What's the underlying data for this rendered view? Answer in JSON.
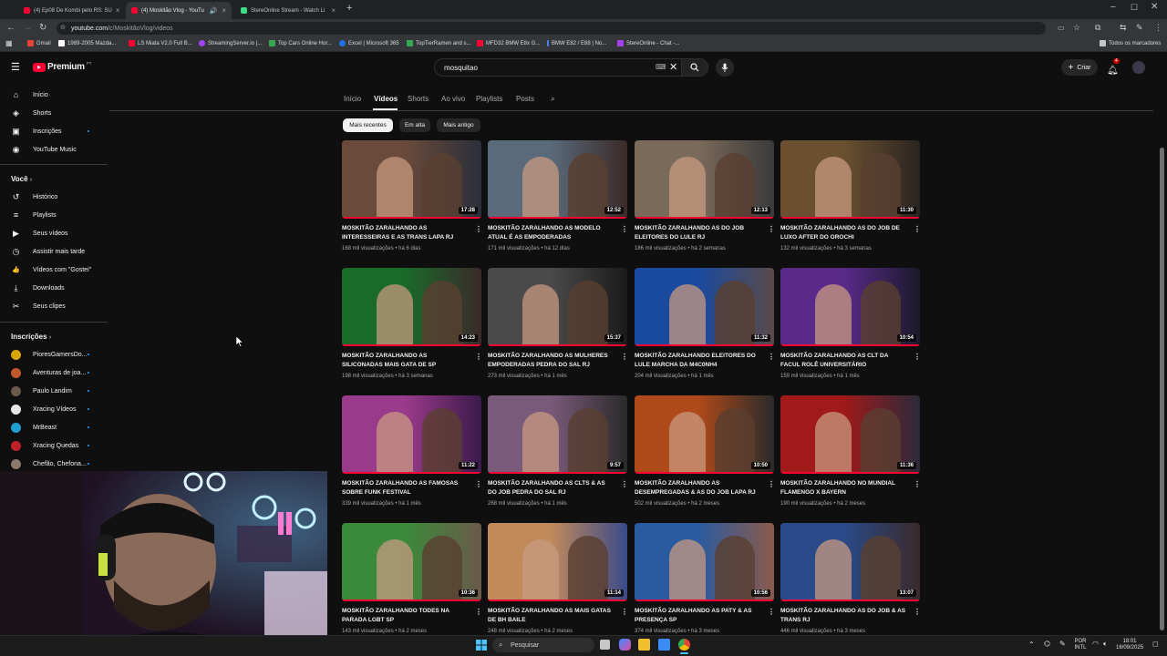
{
  "browser": {
    "tabs": [
      {
        "title": "(4) Ep08 De Kombi pelo RS: SU",
        "active": false,
        "color": "#ff0033"
      },
      {
        "title": "(4) Moskitão Vlog - YouTu",
        "active": true,
        "color": "#ff0033"
      },
      {
        "title": "StereOnline Stream - Watch Li",
        "active": false,
        "color": "#3ddc84"
      }
    ],
    "new_tab": "+",
    "url_host": "youtube.com",
    "url_path": "/c/MoskitãoVlog/videos",
    "bookmarks": [
      {
        "label": "Gmail",
        "color": "#ea4335"
      },
      {
        "label": "1989-2005 Mazda...",
        "color": "#ffffff"
      },
      {
        "label": "LS Miata V2.0 Full B...",
        "color": "#ff0033"
      },
      {
        "label": "StreamingServer.io |...",
        "color": "#a142f4"
      },
      {
        "label": "Top Cars Online Hor...",
        "color": "#34a853"
      },
      {
        "label": "Excel | Microsoft 365",
        "color": "#1a73e8"
      },
      {
        "label": "TopTierRamen and s...",
        "color": "#34a853"
      },
      {
        "label": "MFD32 BMW E8x G...",
        "color": "#ff0033"
      },
      {
        "label": "BMW E82 / E88 | No...",
        "color": "#4285f4"
      },
      {
        "label": "StereOnline - Chat -...",
        "color": "#a142f4"
      }
    ],
    "all_bookmarks": "Todos os marcadores"
  },
  "header": {
    "logo_text": "Premium",
    "logo_sup": "PT",
    "search_value": "mosquitao",
    "create_label": "Criar",
    "notif_count": "4"
  },
  "sidebar": {
    "main": [
      {
        "label": "Início",
        "icon": "home-icon",
        "glyph": "⌂"
      },
      {
        "label": "Shorts",
        "icon": "shorts-icon",
        "glyph": "◈"
      },
      {
        "label": "Inscrições",
        "icon": "subscriptions-icon",
        "glyph": "▣"
      },
      {
        "label": "YouTube Music",
        "icon": "music-icon",
        "glyph": "◉"
      }
    ],
    "you_header": "Você",
    "you": [
      {
        "label": "Histórico",
        "icon": "history-icon",
        "glyph": "↺"
      },
      {
        "label": "Playlists",
        "icon": "playlists-icon",
        "glyph": "≡"
      },
      {
        "label": "Seus vídeos",
        "icon": "your-videos-icon",
        "glyph": "▶"
      },
      {
        "label": "Assistir mais tarde",
        "icon": "watch-later-icon",
        "glyph": "◷"
      },
      {
        "label": "Vídeos com \"Gostei\"",
        "icon": "like-icon",
        "glyph": "👍"
      },
      {
        "label": "Downloads",
        "icon": "download-icon",
        "glyph": "⤓"
      },
      {
        "label": "Seus clipes",
        "icon": "clips-icon",
        "glyph": "✂"
      }
    ],
    "subs_header": "Inscrições",
    "subs": [
      {
        "label": "PioresGamersDo...",
        "color": "#d8a600"
      },
      {
        "label": "Aventuras de joa...",
        "color": "#c0582b"
      },
      {
        "label": "Paulo Landim",
        "color": "#6a5a4a"
      },
      {
        "label": "Xracing Vídeos",
        "color": "#e6e6e6"
      },
      {
        "label": "MrBeast",
        "color": "#20a0d0"
      },
      {
        "label": "Xracing Quedas",
        "color": "#c0202a"
      },
      {
        "label": "Chefão, Chefona...",
        "color": "#8a7a6a"
      }
    ]
  },
  "channel_tabs": [
    "Início",
    "Vídeos",
    "Shorts",
    "Ao vivo",
    "Playlists",
    "Posts"
  ],
  "chips": [
    "Mais recentes",
    "Em alta",
    "Mais antigo"
  ],
  "videos": [
    {
      "title": "MOSKITÃO ZARALHANDO AS INTERESSEIRAS E AS TRANS LAPA RJ",
      "meta": "168 mil visualizações • há 6 dias",
      "duration": "17:28",
      "c1": "#6a4a3a",
      "c2": "#2a2f3a"
    },
    {
      "title": "MOSKITÃO ZARALHANDO AS MODELO ATUAL É AS EMPODERADAS",
      "meta": "171 mil visualizações • há 12 dias",
      "duration": "12:52",
      "c1": "#5a6a7a",
      "c2": "#3a2a28"
    },
    {
      "title": "MOSKITÃO ZARALHANDO AS DO JOB ELEITORES DO LULE RJ",
      "meta": "186 mil visualizações • há 2 semanas",
      "duration": "12:13",
      "c1": "#7a6a5a",
      "c2": "#3a3a3a"
    },
    {
      "title": "MOSKITÃO ZARALHANDO AS DO JOB DE LUXO AFTER DO OROCHI",
      "meta": "132 mil visualizações • há 3 semanas",
      "duration": "11:30",
      "c1": "#6a5030",
      "c2": "#2a2420"
    },
    {
      "title": "MOSKITÃO ZARALHANDO AS SILICONADAS MAIS GATA DE SP",
      "meta": "198 mil visualizações • há 3 semanas",
      "duration": "14:23",
      "c1": "#1a6a2a",
      "c2": "#3a2a2a"
    },
    {
      "title": "MOSKITÃO ZARALHANDO AS MULHERES EMPODERADAS PEDRA DO SAL RJ",
      "meta": "273 mil visualizações • há 1 mês",
      "duration": "15:37",
      "c1": "#4a4a4a",
      "c2": "#1a1a1a"
    },
    {
      "title": "MOSKITÃO ZARALHANDO ELEITORES DO LULE MARCHA DA M4C0NH4",
      "meta": "204 mil visualizações • há 1 mês",
      "duration": "11:32",
      "c1": "#1a4aa0",
      "c2": "#5a4a4a"
    },
    {
      "title": "MOSKITÃO ZARALHANDO AS CLT DA FACUL ROLÊ UNIVERSITÁRIO",
      "meta": "159 mil visualizações • há 1 mês",
      "duration": "10:54",
      "c1": "#5a2a8a",
      "c2": "#1a1a2a"
    },
    {
      "title": "MOSKITÃO ZARALHANDO AS FAMOSAS SOBRE FUNK FESTIVAL",
      "meta": "339 mil visualizações • há 1 mês",
      "duration": "11:22",
      "c1": "#9a3a8a",
      "c2": "#3a1a4a"
    },
    {
      "title": "MOSKITÃO ZARALHANDO AS CLTS & AS DO JOB PEDRA DO SAL RJ",
      "meta": "268 mil visualizações • há 1 mês",
      "duration": "9:57",
      "c1": "#7a5a7a",
      "c2": "#2a2a2a"
    },
    {
      "title": "MOSKITÃO ZARALHANDO AS DESEMPREGADAS & AS DO JOB LAPA RJ",
      "meta": "502 mil visualizações • há 2 meses",
      "duration": "10:50",
      "c1": "#b04a1a",
      "c2": "#2a2a2a"
    },
    {
      "title": "MOSKITÃO ZARALHANDO NO MUNDIAL FLAMENGO X BAYERN",
      "meta": "190 mil visualizações • há 2 meses",
      "duration": "11:36",
      "c1": "#a01a1a",
      "c2": "#2a2a3a"
    },
    {
      "title": "MOSKITÃO ZARALHANDO TODES NA PARADA LGBT SP",
      "meta": "143 mil visualizações • há 2 meses",
      "duration": "10:36",
      "c1": "#3a8a3a",
      "c2": "#6a5a4a"
    },
    {
      "title": "MOSKITÃO ZARALHANDO AS MAIS GATAS DE BH BAILE",
      "meta": "248 mil visualizações • há 2 meses",
      "duration": "11:14",
      "c1": "#c08a5a",
      "c2": "#3a4a8a"
    },
    {
      "title": "MOSKITÃO ZARALHANDO AS PATY & AS PRESENÇA SP",
      "meta": "374 mil visualizações • há 3 meses",
      "duration": "10:56",
      "c1": "#2a5aa0",
      "c2": "#8a5a4a"
    },
    {
      "title": "MOSKITÃO ZARALHANDO AS DO JOB & AS TRANS RJ",
      "meta": "446 mil visualizações • há 3 meses",
      "duration": "13:07",
      "c1": "#2a4a8a",
      "c2": "#3a2a2a"
    }
  ],
  "taskbar": {
    "search_label": "Pesquisar",
    "lang_top": "POR",
    "lang_bottom": "INTL",
    "time": "18:01",
    "date": "16/09/2025"
  }
}
